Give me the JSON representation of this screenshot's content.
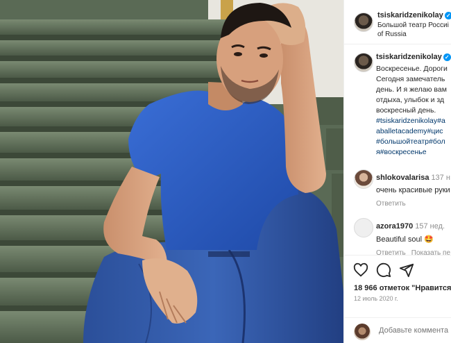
{
  "post": {
    "author": "tsiskaridzenikolay",
    "location_line1": "Большой театр Россиі",
    "location_line2": "of Russia",
    "caption_lines": [
      "Воскресенье. Дороги",
      "Сегодня замечатель",
      "день. И я желаю вам",
      "отдыха, улыбок и зд",
      "воскресный день."
    ],
    "hashtag_lines": [
      "#tsiskaridzenikolay#а",
      "aballetacademy#цис",
      "#большойтеатр#бол",
      "я#воскресенье"
    ],
    "photo_alt": "photo"
  },
  "comments": [
    {
      "user": "shlokovalarisa",
      "time": "137 н",
      "text": "очень красивые руки",
      "actions": [
        "Ответить"
      ]
    },
    {
      "user": "azora1970",
      "time": "157 нед.",
      "text": "Beautiful soul 🤩",
      "actions": [
        "Ответить",
        "Показать пе"
      ]
    }
  ],
  "actions_bar": {
    "icons": [
      "heart-icon",
      "comment-icon",
      "share-icon"
    ],
    "likes": "18 966 отметок \"Нравится",
    "date": "12 июль 2020 г."
  },
  "add_comment": {
    "placeholder": "Добавьте коммента"
  },
  "colors": {
    "link": "#00376b",
    "verified": "#0095f6",
    "muted": "#8e8e8e",
    "shirt": "#2f5fc4",
    "jeans": "#2c4f9a"
  }
}
